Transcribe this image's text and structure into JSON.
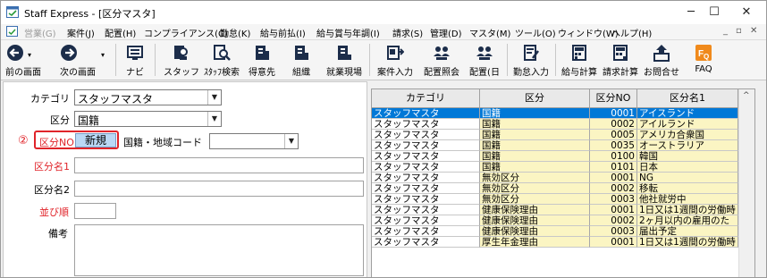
{
  "window": {
    "title": "Staff Express - [区分マスタ]",
    "minimize": "─",
    "maximize": "☐",
    "close": "✕"
  },
  "menu": [
    {
      "label": "営業(G)",
      "disabled": true
    },
    {
      "label": "案件(J)"
    },
    {
      "label": "配置(H)"
    },
    {
      "label": "コンプライアンス(C)"
    },
    {
      "label": "勤怠(K)"
    },
    {
      "label": "給与前払(I)"
    },
    {
      "label": "給与賞与年調(I)"
    },
    {
      "label": "請求(S)"
    },
    {
      "label": "管理(D)"
    },
    {
      "label": "マスタ(M)"
    },
    {
      "label": "ツール(O)"
    },
    {
      "label": "ウィンドウ(W)"
    },
    {
      "label": "ヘルプ(H)"
    }
  ],
  "mdi_controls": {
    "minimize": "_",
    "restore": "▫",
    "close": "✕"
  },
  "toolbar": [
    {
      "label": "前の画面",
      "icon": "arrow-left-icon"
    },
    {
      "label": "次の画面",
      "icon": "arrow-right-icon"
    },
    {
      "label": "ナビ",
      "icon": "navi-icon"
    },
    {
      "label": "スタッフ",
      "icon": "staff-icon"
    },
    {
      "label": "ｽﾀｯﾌ検索",
      "icon": "staff-search-icon"
    },
    {
      "label": "得意先",
      "icon": "customer-icon"
    },
    {
      "label": "組織",
      "icon": "organization-icon"
    },
    {
      "label": "就業現場",
      "icon": "worksite-icon"
    },
    {
      "label": "案件入力",
      "icon": "project-entry-icon"
    },
    {
      "label": "配置照会",
      "icon": "placement-inquiry-icon"
    },
    {
      "label": "配置(日",
      "icon": "placement-daily-icon"
    },
    {
      "label": "勤怠入力",
      "icon": "attendance-entry-icon"
    },
    {
      "label": "給与計算",
      "icon": "payroll-calc-icon"
    },
    {
      "label": "請求計算",
      "icon": "billing-calc-icon"
    },
    {
      "label": "お問合せ",
      "icon": "inquiry-icon"
    },
    {
      "label": "FAQ",
      "icon": "faq-icon"
    }
  ],
  "form": {
    "category_label": "カテゴリ",
    "category_value": "スタッフマスタ",
    "kubun_label": "区分",
    "kubun_value": "国籍",
    "callout_number": "②",
    "kubun_no_label": "区分NO",
    "kubun_no_value": "新規",
    "country_code_label": "国籍・地域コード",
    "country_code_value": "",
    "kubun_name1_label": "区分名1",
    "kubun_name2_label": "区分名2",
    "sort_order_label": "並び順",
    "remarks_label": "備考"
  },
  "colors": {
    "accent_red": "#e0242a",
    "selected_row": "#0078d7",
    "row_alt": "#fbf5c3"
  },
  "grid": {
    "headers": [
      "カテゴリ",
      "区分",
      "区分NO",
      "区分名1"
    ],
    "selected_index": 0,
    "rows": [
      [
        "スタッフマスタ",
        "国籍",
        "0001",
        "アイスランド"
      ],
      [
        "スタッフマスタ",
        "国籍",
        "0002",
        "アイルランド"
      ],
      [
        "スタッフマスタ",
        "国籍",
        "0005",
        "アメリカ合衆国"
      ],
      [
        "スタッフマスタ",
        "国籍",
        "0035",
        "オーストラリア"
      ],
      [
        "スタッフマスタ",
        "国籍",
        "0100",
        "韓国"
      ],
      [
        "スタッフマスタ",
        "国籍",
        "0101",
        "日本"
      ],
      [
        "スタッフマスタ",
        "無効区分",
        "0001",
        "NG"
      ],
      [
        "スタッフマスタ",
        "無効区分",
        "0002",
        "移転"
      ],
      [
        "スタッフマスタ",
        "無効区分",
        "0003",
        "他社就労中"
      ],
      [
        "スタッフマスタ",
        "健康保険理由",
        "0001",
        "1日又は1週間の労働時"
      ],
      [
        "スタッフマスタ",
        "健康保険理由",
        "0002",
        "2ヶ月以内の雇用のた"
      ],
      [
        "スタッフマスタ",
        "健康保険理由",
        "0003",
        "届出予定"
      ],
      [
        "スタッフマスタ",
        "厚生年金理由",
        "0001",
        "1日又は1週間の労働時"
      ]
    ]
  }
}
